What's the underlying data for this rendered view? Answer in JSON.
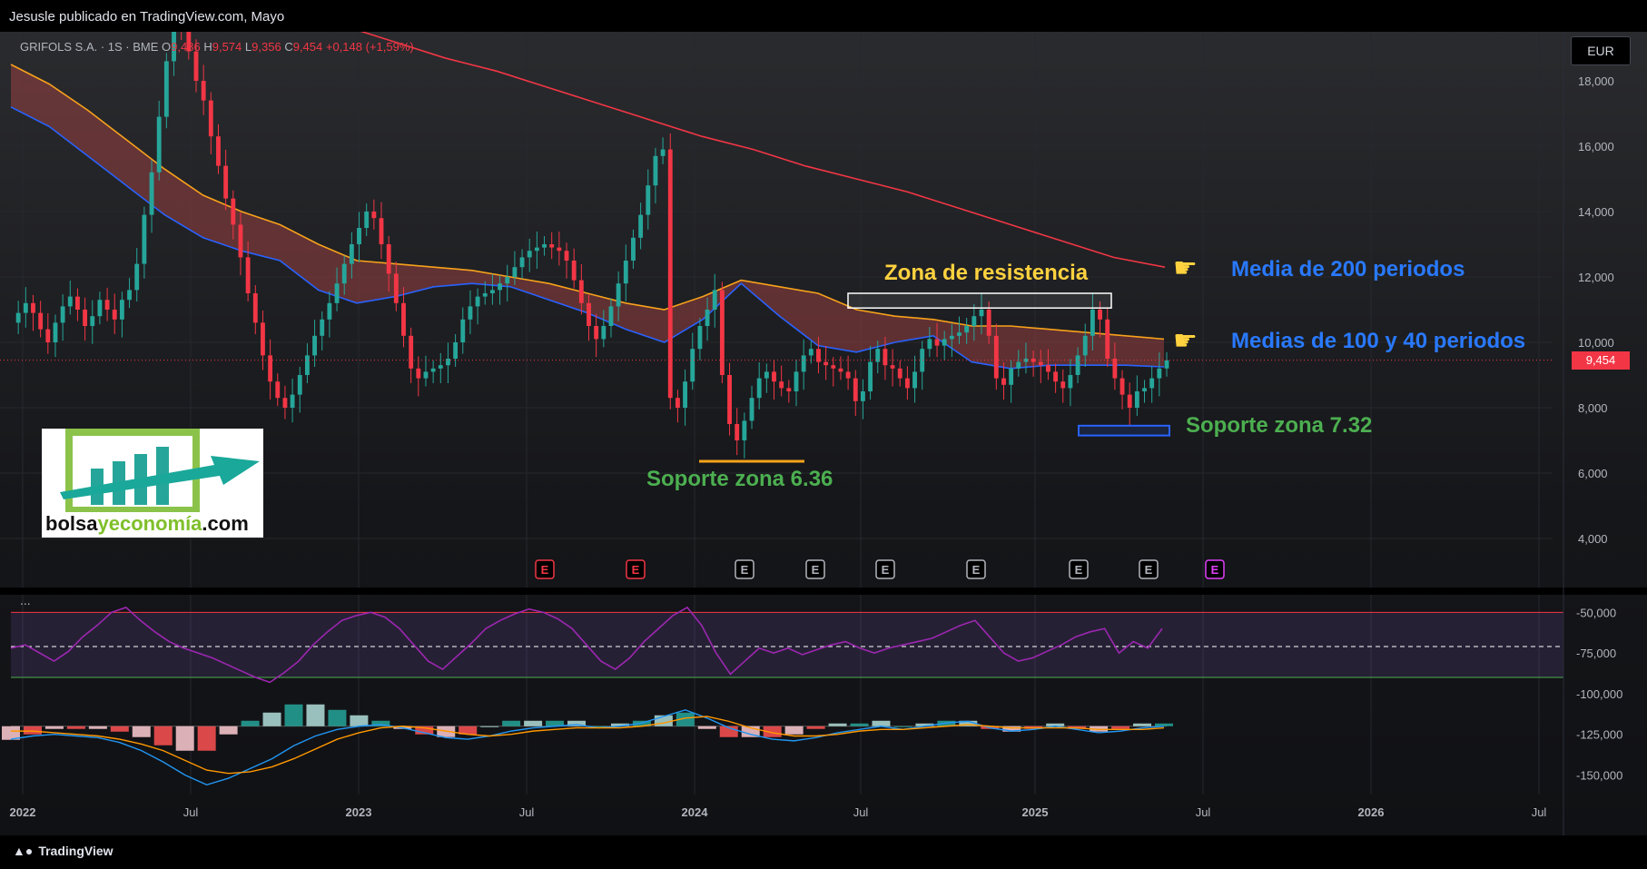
{
  "publisher_line": "Jesusle publicado en TradingView.com, Mayo",
  "legend": {
    "symbol": "GRIFOLS S.A. · 1S · BME",
    "o_label": "O",
    "o_value": "9,486",
    "h_label": "H",
    "h_value": "9,574",
    "l_label": "L",
    "l_value": "9,356",
    "c_label": "C",
    "c_value": "9,454",
    "change": "+0,148 (+1,59%)"
  },
  "currency": "EUR",
  "last_price_tag": "9,454",
  "annotations": {
    "resistance": "Zona de resistencia",
    "ma200": "Media de 200 periodos",
    "ma100_40": "Medias de 100 y 40 periodos",
    "support_732": "Soporte zona 7.32",
    "support_636": "Soporte zona 6.36"
  },
  "hand_icon": "pointing-hand-icon",
  "earnings_marker": "E",
  "indicator_menu": "...",
  "footer_brand": "TradingView",
  "logo": {
    "part1": "bolsa",
    "part2": "y",
    "part3": "economía",
    "part4": ".com"
  },
  "colors": {
    "up": "#26a69a",
    "down": "#f23645",
    "ma40": "#2962ff",
    "ma100": "#f7a21b",
    "ma200": "#f23645",
    "rsi": "#9c27b0",
    "ann_green": "#4caf50",
    "ann_blue": "#2979ff",
    "ann_yellow": "#ffd23f"
  },
  "chart_data": {
    "type": "candlestick",
    "timeframe": "1S",
    "price_axis": {
      "ticks": [
        "4,000",
        "6,000",
        "8,000",
        "10,000",
        "12,000",
        "14,000",
        "16,000",
        "18,000"
      ],
      "ylim": [
        2.5,
        19.5
      ]
    },
    "time_axis": {
      "ticks": [
        "2022",
        "Jul",
        "2023",
        "Jul",
        "2024",
        "Jul",
        "2025",
        "Jul",
        "2026",
        "Jul"
      ]
    },
    "close_series": [
      10.6,
      10.9,
      11.2,
      10.9,
      10.4,
      10.0,
      10.6,
      11.1,
      11.4,
      11.0,
      10.5,
      10.8,
      11.3,
      11.0,
      10.7,
      11.3,
      11.6,
      12.4,
      13.9,
      15.2,
      16.9,
      18.6,
      20.0,
      19.8,
      18.9,
      18.0,
      17.4,
      16.3,
      15.4,
      14.4,
      13.6,
      12.6,
      11.5,
      10.6,
      9.6,
      8.8,
      8.3,
      8.0,
      8.4,
      9.0,
      9.6,
      10.2,
      10.7,
      11.2,
      11.8,
      12.4,
      13.0,
      13.5,
      14.0,
      13.8,
      13.0,
      12.1,
      11.2,
      10.2,
      9.2,
      8.9,
      9.1,
      9.2,
      9.3,
      9.5,
      10.0,
      10.7,
      11.1,
      11.4,
      11.5,
      11.6,
      11.8,
      12.0,
      12.3,
      12.6,
      12.8,
      12.9,
      13.0,
      12.9,
      12.8,
      12.5,
      11.9,
      11.2,
      10.5,
      10.1,
      10.5,
      11.1,
      11.8,
      12.5,
      13.2,
      13.9,
      14.8,
      15.7,
      15.9,
      8.3,
      8.0,
      8.8,
      9.8,
      10.5,
      11.0,
      11.6,
      9.0,
      7.5,
      7.0,
      7.6,
      8.3,
      8.9,
      9.1,
      8.8,
      8.6,
      8.5,
      9.1,
      9.6,
      9.8,
      9.4,
      9.3,
      9.2,
      9.1,
      8.9,
      8.2,
      8.5,
      9.4,
      9.8,
      9.3,
      9.2,
      8.9,
      8.6,
      9.1,
      9.8,
      10.1,
      9.9,
      10.1,
      10.2,
      10.3,
      10.5,
      10.8,
      11.0,
      10.2,
      8.9,
      8.7,
      9.2,
      9.4,
      9.5,
      9.4,
      9.3,
      9.1,
      8.8,
      8.6,
      9.0,
      9.6,
      10.2,
      11.0,
      10.7,
      9.5,
      8.9,
      8.4,
      8.0,
      8.5,
      8.6,
      8.9,
      9.2,
      9.45
    ],
    "ma40": {
      "name": "Media 40",
      "values": [
        17.2,
        16.6,
        15.7,
        14.8,
        13.9,
        13.2,
        12.8,
        12.5,
        11.6,
        11.2,
        11.4,
        11.7,
        11.8,
        11.7,
        11.3,
        10.9,
        10.4,
        10.0,
        10.7,
        11.8,
        10.8,
        9.9,
        9.7,
        10.0,
        10.2,
        9.4,
        9.2,
        9.3,
        9.3,
        9.3,
        9.25
      ]
    },
    "ma100": {
      "name": "Media 100",
      "values": [
        18.5,
        17.9,
        17.1,
        16.2,
        15.3,
        14.5,
        14.0,
        13.6,
        13.0,
        12.5,
        12.4,
        12.3,
        12.2,
        12.0,
        11.8,
        11.5,
        11.2,
        11.0,
        11.4,
        11.9,
        11.7,
        11.5,
        11.0,
        10.8,
        10.7,
        10.5,
        10.5,
        10.4,
        10.3,
        10.2,
        10.1
      ]
    },
    "ma200": {
      "name": "Media 200",
      "values": [
        22.0,
        21.5,
        20.9,
        20.3,
        19.7,
        19.2,
        18.7,
        18.3,
        17.8,
        17.3,
        16.8,
        16.3,
        15.9,
        15.4,
        15.0,
        14.6,
        14.1,
        13.6,
        13.1,
        12.6,
        12.3
      ]
    },
    "earnings_markers": 8,
    "rsi": {
      "axis_ticks": [
        "-50,000",
        "-75,000",
        "-100,000",
        "-125,000",
        "-150,000"
      ],
      "ylim": [
        -162,
        -42
      ],
      "upper_band": -50,
      "mid_band": -71,
      "lower_band": -90
    },
    "rsi_series": [
      -72,
      -70,
      -75,
      -80,
      -74,
      -65,
      -58,
      -50,
      -47,
      -55,
      -62,
      -68,
      -72,
      -75,
      -78,
      -82,
      -86,
      -90,
      -93,
      -87,
      -80,
      -70,
      -62,
      -55,
      -52,
      -50,
      -53,
      -60,
      -70,
      -80,
      -85,
      -77,
      -69,
      -60,
      -55,
      -51,
      -48,
      -50,
      -54,
      -60,
      -70,
      -80,
      -85,
      -78,
      -68,
      -60,
      -52,
      -47,
      -58,
      -75,
      -88,
      -80,
      -72,
      -75,
      -72,
      -76,
      -73,
      -70,
      -68,
      -72,
      -75,
      -72,
      -70,
      -68,
      -66,
      -62,
      -58,
      -55,
      -65,
      -75,
      -80,
      -78,
      -74,
      -70,
      -65,
      -62,
      -60,
      -75,
      -68,
      -72,
      -60
    ],
    "macd": {
      "zero_level": -120,
      "macd_line": [
        -128,
        -126,
        -125,
        -126,
        -127,
        -130,
        -135,
        -142,
        -150,
        -156,
        -152,
        -146,
        -140,
        -132,
        -126,
        -122,
        -120,
        -119,
        -121,
        -124,
        -127,
        -128,
        -126,
        -123,
        -121,
        -120,
        -119,
        -121,
        -120,
        -118,
        -114,
        -110,
        -115,
        -121,
        -125,
        -128,
        -129,
        -127,
        -124,
        -122,
        -120,
        -122,
        -120,
        -118,
        -117,
        -121,
        -123,
        -122,
        -120,
        -122,
        -124,
        -123,
        -121,
        -120
      ],
      "signal_line": [
        -123,
        -123,
        -124,
        -125,
        -126,
        -128,
        -131,
        -135,
        -141,
        -147,
        -149,
        -148,
        -145,
        -140,
        -134,
        -128,
        -124,
        -121,
        -120,
        -121,
        -123,
        -125,
        -126,
        -125,
        -123,
        -122,
        -121,
        -121,
        -121,
        -120,
        -118,
        -115,
        -114,
        -117,
        -121,
        -124,
        -126,
        -126,
        -125,
        -123,
        -122,
        -122,
        -121,
        -120,
        -119,
        -120,
        -121,
        -121,
        -121,
        -121,
        -122,
        -122,
        -122,
        -121
      ]
    }
  }
}
